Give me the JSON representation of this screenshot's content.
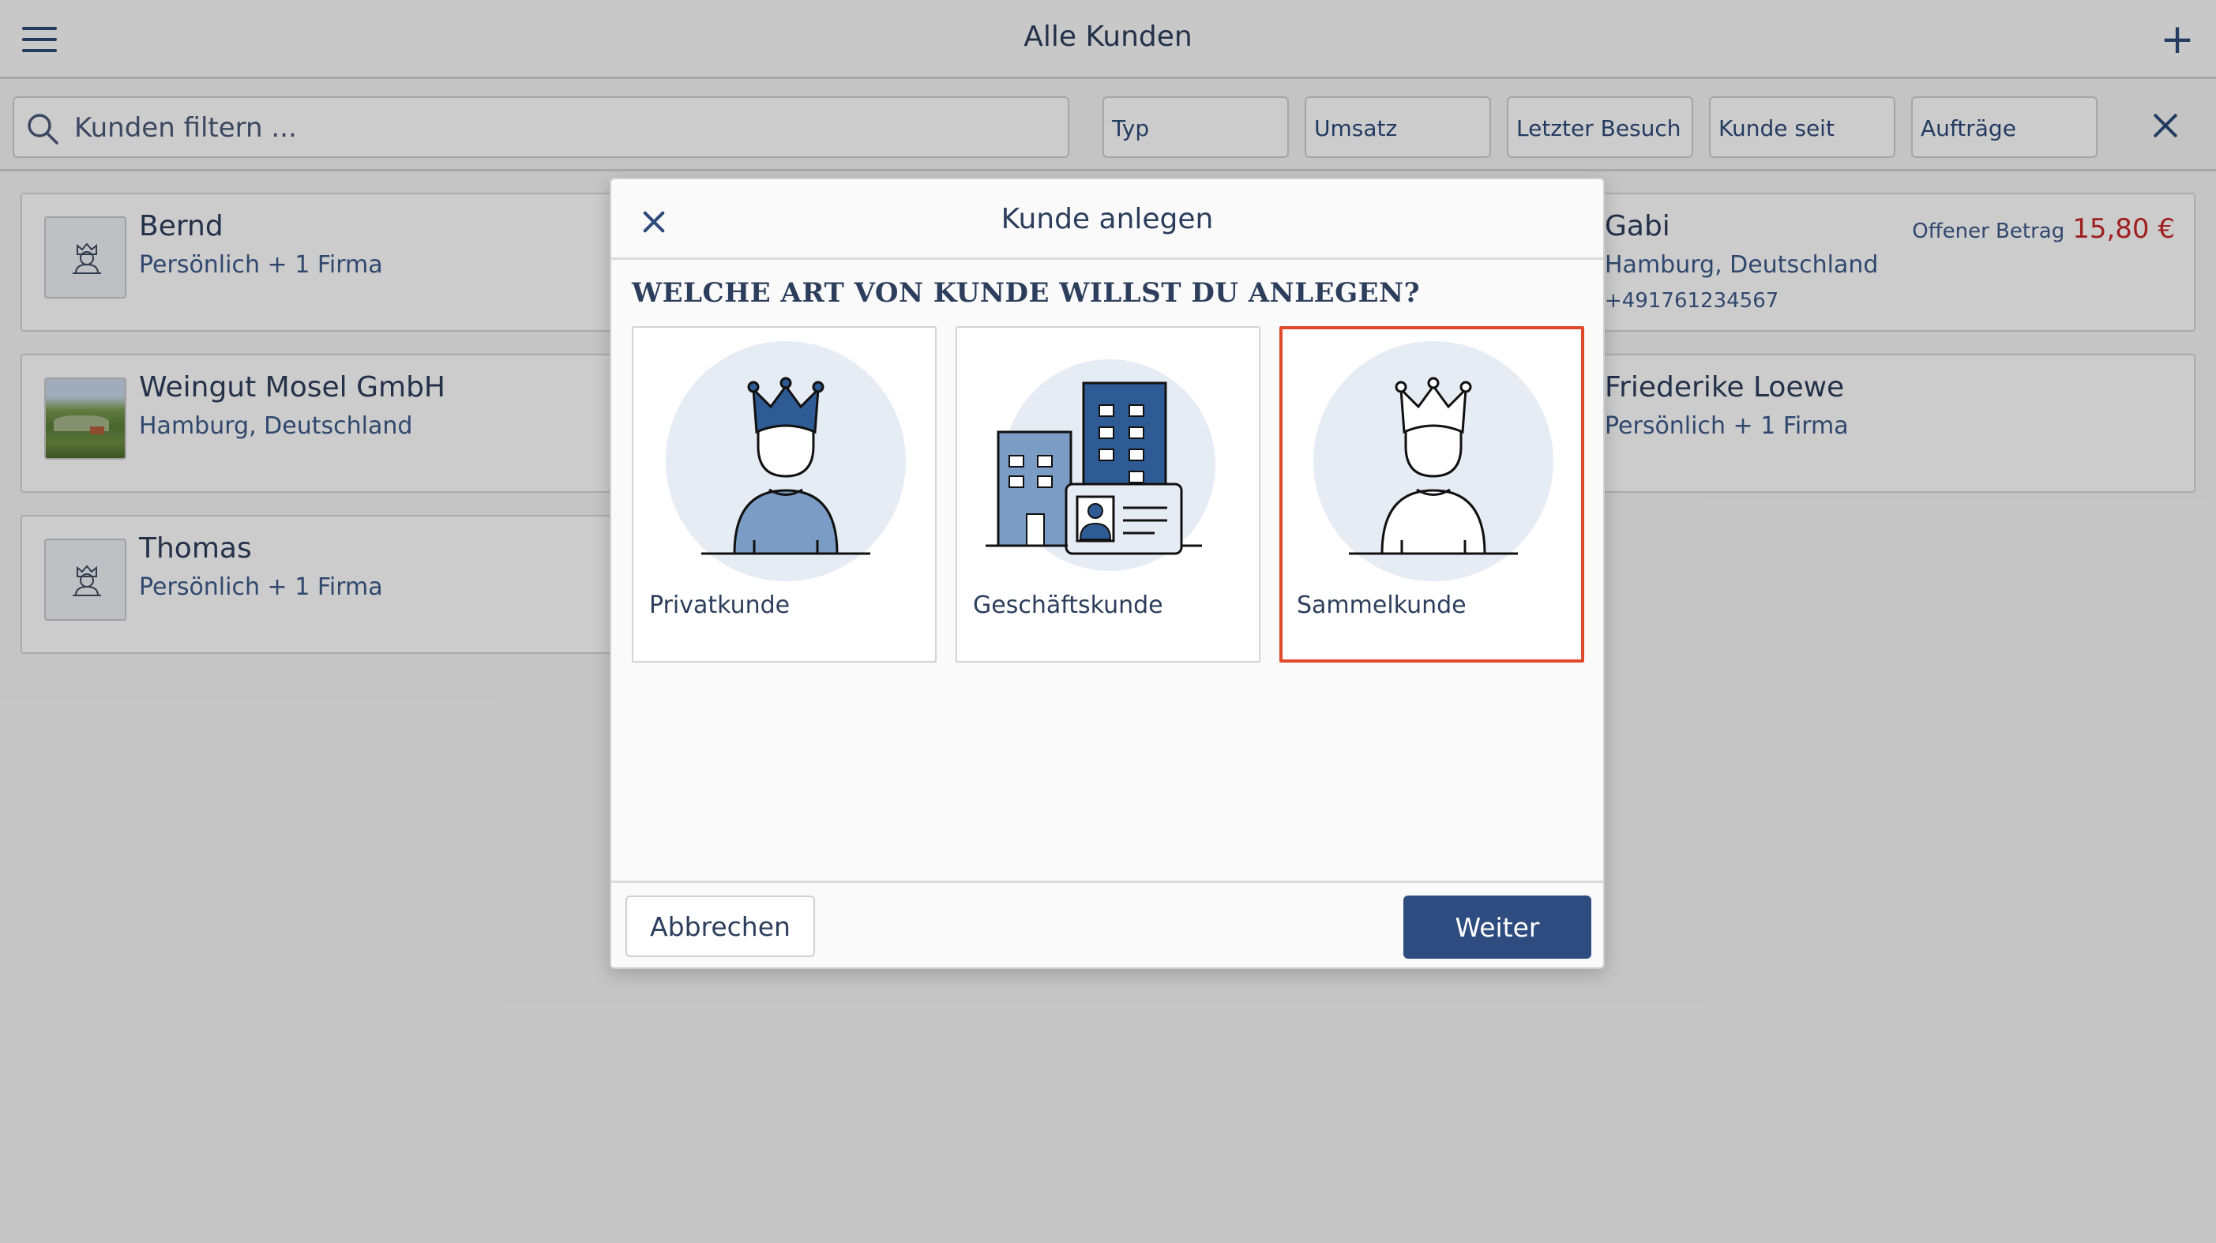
{
  "header": {
    "title": "Alle Kunden",
    "menu_icon": "hamburger-menu-icon",
    "add_icon": "plus-icon",
    "add_label": "+"
  },
  "filter": {
    "search_placeholder": "Kunden filtern ...",
    "search_value": "",
    "chips": [
      "Typ",
      "Umsatz",
      "Letzter Besuch",
      "Kunde seit",
      "Aufträge"
    ],
    "clear_icon": "close-icon"
  },
  "customers": [
    {
      "name": "Bernd",
      "sub": "Persönlich + 1 Firma",
      "avatar": "customer-crown-icon"
    },
    {
      "name": "Weingut Mosel GmbH",
      "sub": "Hamburg, Deutschland",
      "avatar": "vineyard-photo"
    },
    {
      "name": "Thomas",
      "sub": "Persönlich + 1 Firma",
      "avatar": "customer-crown-icon"
    },
    {
      "name": "Gabi",
      "sub": "Hamburg, Deutschland",
      "phone": "+491761234567",
      "open_label": "Offener Betrag",
      "open_amount": "15,80 €"
    },
    {
      "name": "Friederike Loewe",
      "sub": "Persönlich + 1 Firma"
    }
  ],
  "modal": {
    "title": "Kunde anlegen",
    "question": "WELCHE ART VON KUNDE WILLST DU ANLEGEN?",
    "options": [
      {
        "label": "Privatkunde",
        "icon": "private-customer-icon",
        "selected": false
      },
      {
        "label": "Geschäftskunde",
        "icon": "business-customer-icon",
        "selected": false
      },
      {
        "label": "Sammelkunde",
        "icon": "collective-customer-icon",
        "selected": true
      }
    ],
    "cancel_label": "Abbrechen",
    "next_label": "Weiter"
  },
  "colors": {
    "primary": "#2f4c80",
    "text": "#2c3e5c",
    "selection": "#e0492a",
    "amount_due": "#c62828",
    "icon_circle": "#e6ecf4",
    "icon_fill": "#7b9cc4",
    "icon_dark": "#2e5b94"
  }
}
